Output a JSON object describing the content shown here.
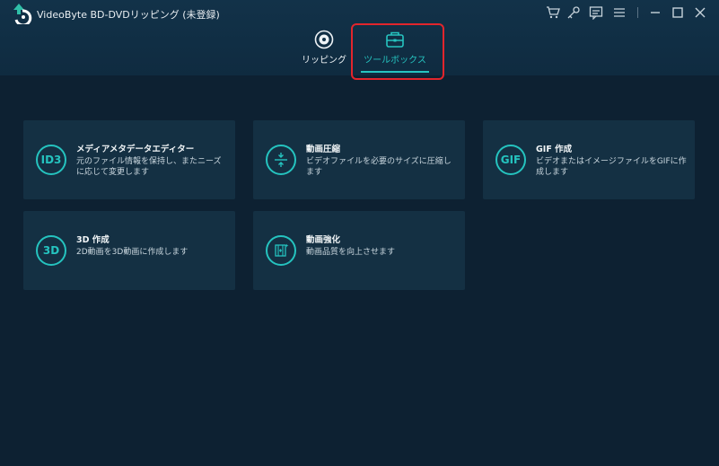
{
  "app": {
    "title": "VideoByte BD-DVDリッピング (未登録)"
  },
  "title_icons": [
    "cart-icon",
    "key-icon",
    "feedback-icon",
    "menu-icon",
    "minimize-icon",
    "maximize-icon",
    "close-icon"
  ],
  "tabs": [
    {
      "label": "リッピング",
      "icon": "disc-icon",
      "active": false
    },
    {
      "label": "ツールボックス",
      "icon": "toolbox-icon",
      "active": true
    }
  ],
  "tools": [
    {
      "icon_text": "ID3",
      "title": "メディアメタデータエディター",
      "desc": "元のファイル情報を保持し、またニーズに応じて変更します"
    },
    {
      "icon_text": "",
      "icon": "compress-icon",
      "title": "動画圧縮",
      "desc": "ビデオファイルを必要のサイズに圧縮します"
    },
    {
      "icon_text": "GIF",
      "title": "GIF 作成",
      "desc": "ビデオまたはイメージファイルをGIFに作成します"
    },
    {
      "icon_text": "3D",
      "title": "3D 作成",
      "desc": "2D動画を3D動画に作成します"
    },
    {
      "icon_text": "",
      "icon": "enhance-icon",
      "title": "動画強化",
      "desc": "動画品質を向上させます"
    }
  ],
  "colors": {
    "accent": "#26c4c0",
    "background": "#0d2132",
    "card": "#143043",
    "highlight": "#e2252c"
  }
}
